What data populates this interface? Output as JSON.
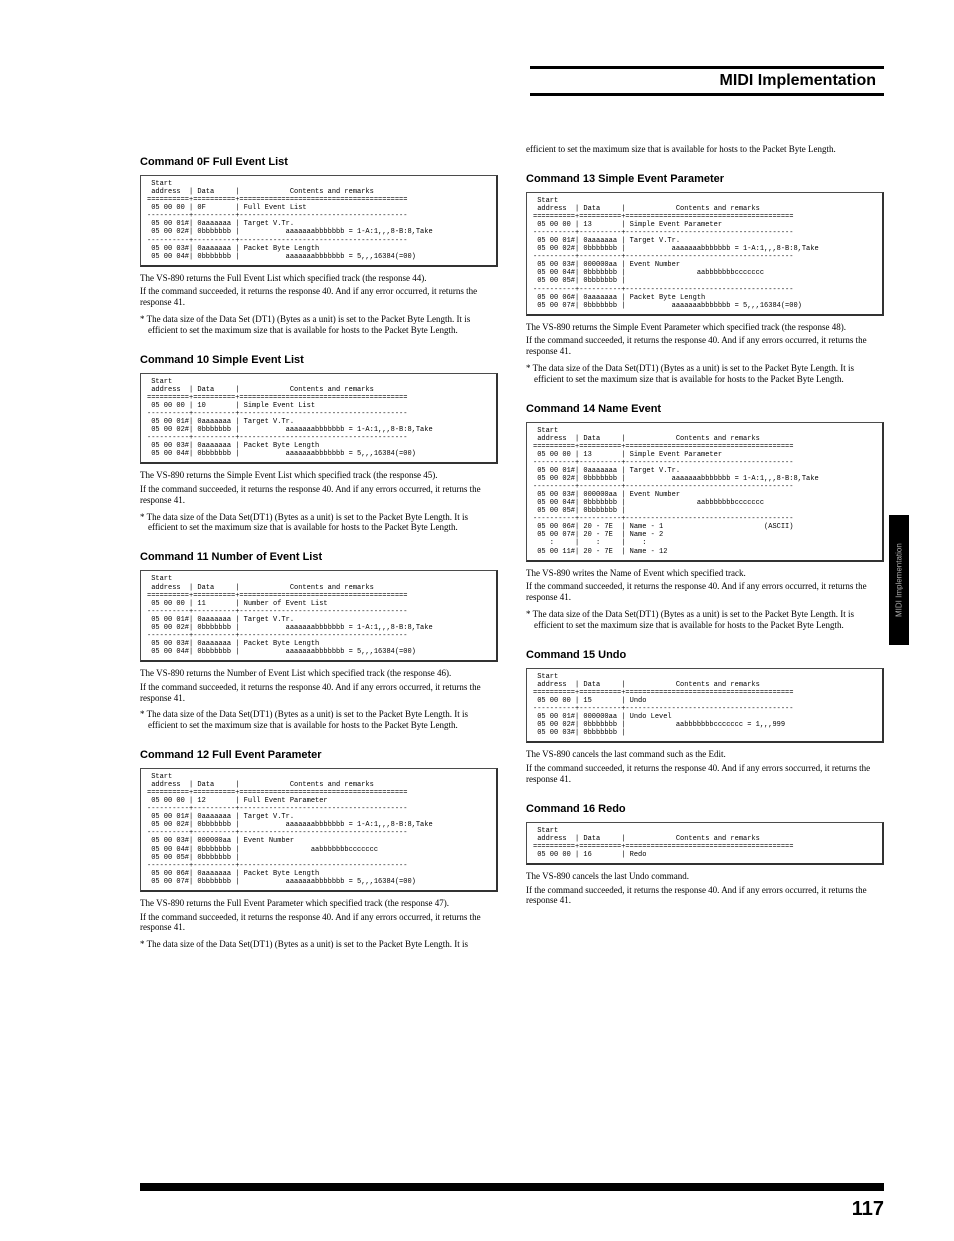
{
  "header": {
    "title": "MIDI Implementation"
  },
  "side_tab": "MIDI Implementation",
  "page_number": "117",
  "left": {
    "s0F": {
      "title": "Command 0F Full Event List",
      "table": " Start\n address  | Data     |            Contents and remarks\n==========+==========+========================================\n 05 00 00 | 0F       | Full Event List\n----------+----------+----------------------------------------\n 05 00 01#| 0aaaaaaa | Target V.Tr.\n 05 00 02#| 0bbbbbbb |           aaaaaaabbbbbbb = 1-A:1,,,8-B:8,Take\n----------+----------+----------------------------------------\n 05 00 03#| 0aaaaaaa | Packet Byte Length\n 05 00 04#| 0bbbbbbb |           aaaaaaabbbbbbb = 5,,,16384(=00)",
      "p1": "The VS-890 returns the Full Event List which specified track (the response 44).",
      "p2": "If the command succeeded, it returns the response 40. And if any error occurred, it returns the response 41.",
      "note": "* The data size of the Data Set (DT1) (Bytes as a unit) is set to the Packet Byte Length. It is efficient to set the maximum size that is available for hosts to the Packet Byte Length."
    },
    "s10": {
      "title": "Command 10 Simple Event List",
      "table": " Start\n address  | Data     |            Contents and remarks\n==========+==========+========================================\n 05 00 00 | 10       | Simple Event List\n----------+----------+----------------------------------------\n 05 00 01#| 0aaaaaaa | Target V.Tr.\n 05 00 02#| 0bbbbbbb |           aaaaaaabbbbbbb = 1-A:1,,,8-B:8,Take\n----------+----------+----------------------------------------\n 05 00 03#| 0aaaaaaa | Packet Byte Length\n 05 00 04#| 0bbbbbbb |           aaaaaaabbbbbbb = 5,,,16384(=00)",
      "p1": "The VS-890 returns the Simple Event List which specified track (the response 45).",
      "p2": "If the command succeeded, it returns the response 40. And if any errors occurred, it returns the response 41.",
      "note": "* The data size of the Data Set(DT1) (Bytes as a unit) is set to the Packet Byte Length. It is efficient to set the maximum size that is available for hosts to the Packet Byte Length."
    },
    "s11": {
      "title": "Command 11 Number of Event List",
      "table": " Start\n address  | Data     |            Contents and remarks\n==========+==========+========================================\n 05 00 00 | 11       | Number of Event List\n----------+----------+----------------------------------------\n 05 00 01#| 0aaaaaaa | Target V.Tr.\n 05 00 02#| 0bbbbbbb |           aaaaaaabbbbbbb = 1-A:1,,,8-B:8,Take\n----------+----------+----------------------------------------\n 05 00 03#| 0aaaaaaa | Packet Byte Length\n 05 00 04#| 0bbbbbbb |           aaaaaaabbbbbbb = 5,,,16384(=00)",
      "p1": "The VS-890 returns the Number of Event List which specified track (the response 46).",
      "p2": "If the command succeeded, it returns the response 40. And if any errors occurred, it returns the response 41.",
      "note": "* The data size of the Data Set(DT1) (Bytes as a unit) is set to the Packet Byte Length. It is efficient to set the maximum size that is available for hosts to the Packet Byte Length."
    },
    "s12": {
      "title": "Command 12 Full Event Parameter",
      "table": " Start\n address  | Data     |            Contents and remarks\n==========+==========+========================================\n 05 00 00 | 12       | Full Event Parameter\n----------+----------+----------------------------------------\n 05 00 01#| 0aaaaaaa | Target V.Tr.\n 05 00 02#| 0bbbbbbb |           aaaaaaabbbbbbb = 1-A:1,,,8-B:8,Take\n----------+----------+----------------------------------------\n 05 00 03#| 000000aa | Event Number\n 05 00 04#| 0bbbbbbb |                 aabbbbbbbccccccc\n 05 00 05#| 0bbbbbbb |\n----------+----------+----------------------------------------\n 05 00 06#| 0aaaaaaa | Packet Byte Length\n 05 00 07#| 0bbbbbbb |           aaaaaaabbbbbbb = 5,,,16384(=00)",
      "p1": "The VS-890 returns the Full Event Parameter which specified track (the response 47).",
      "p2": "If the command succeeded, it returns the response 40. And if any errors occurred, it returns the response 41.",
      "note": "* The data size of the Data Set(DT1) (Bytes as a unit) is set to the Packet Byte Length. It is"
    }
  },
  "right": {
    "cont": "efficient to set the maximum size that is available for hosts to the Packet Byte Length.",
    "s13": {
      "title": "Command 13 Simple Event Parameter",
      "table": " Start\n address  | Data     |            Contents and remarks\n==========+==========+========================================\n 05 00 00 | 13       | Simple Event Parameter\n----------+----------+----------------------------------------\n 05 00 01#| 0aaaaaaa | Target V.Tr.\n 05 00 02#| 0bbbbbbb |           aaaaaaabbbbbbb = 1-A:1,,,8-B:8,Take\n----------+----------+----------------------------------------\n 05 00 03#| 000000aa | Event Number\n 05 00 04#| 0bbbbbbb |                 aabbbbbbbccccccc\n 05 00 05#| 0bbbbbbb |\n----------+----------+----------------------------------------\n 05 00 06#| 0aaaaaaa | Packet Byte Length\n 05 00 07#| 0bbbbbbb |           aaaaaaabbbbbbb = 5,,,16384(=00)",
      "p1": "The VS-890 returns the Simple Event Parameter which specified track (the response 48).",
      "p2": "If the command succeeded, it returns the response 40. And if any errors occurred, it returns the response 41.",
      "note": "* The data size of the Data Set(DT1) (Bytes as a unit) is set to the Packet Byte Length. It is efficient to set the maximum size that is available for hosts to the Packet Byte Length."
    },
    "s14": {
      "title": "Command 14 Name Event",
      "table": " Start\n address  | Data     |            Contents and remarks\n==========+==========+========================================\n 05 00 00 | 13       | Simple Event Parameter\n----------+----------+----------------------------------------\n 05 00 01#| 0aaaaaaa | Target V.Tr.\n 05 00 02#| 0bbbbbbb |           aaaaaaabbbbbbb = 1-A:1,,,8-B:8,Take\n----------+----------+----------------------------------------\n 05 00 03#| 000000aa | Event Number\n 05 00 04#| 0bbbbbbb |                 aabbbbbbbccccccc\n 05 00 05#| 0bbbbbbb |\n----------+----------+----------------------------------------\n 05 00 06#| 20 - 7E  | Name - 1                        (ASCII)\n 05 00 07#| 20 - 7E  | Name - 2\n    :     |    :     |    :\n 05 00 11#| 20 - 7E  | Name - 12",
      "p1": "The VS-890 writes the Name of Event which specified track.",
      "p2": "If the command succeeded, it returns the response 40. And if any errors occurred, it returns the response 41.",
      "note": "* The data size of the Data Set(DT1) (Bytes as a unit) is set to the Packet Byte Length. It is efficient to set the maximum size that is available for hosts to the Packet Byte Length."
    },
    "s15": {
      "title": "Command 15 Undo",
      "table": " Start\n address  | Data     |            Contents and remarks\n==========+==========+========================================\n 05 00 00 | 15       | Undo\n----------+----------+----------------------------------------\n 05 00 01#| 000000aa | Undo Level\n 05 00 02#| 0bbbbbbb |            aabbbbbbbccccccc = 1,,,999\n 05 00 03#| 0bbbbbbb |",
      "p1": "The VS-890 cancels the last command such as the Edit.",
      "p2": "If the command succeeded, it returns the response 40. And if any errors soccurred, it returns the response 41."
    },
    "s16": {
      "title": "Command 16 Redo",
      "table": " Start\n address  | Data     |            Contents and remarks\n==========+==========+========================================\n 05 00 00 | 16       | Redo",
      "p1": "The VS-890 cancels the last Undo command.",
      "p2": "If the command succeeded, it returns the response 40. And if any errors occurred, it returns the response 41."
    }
  }
}
